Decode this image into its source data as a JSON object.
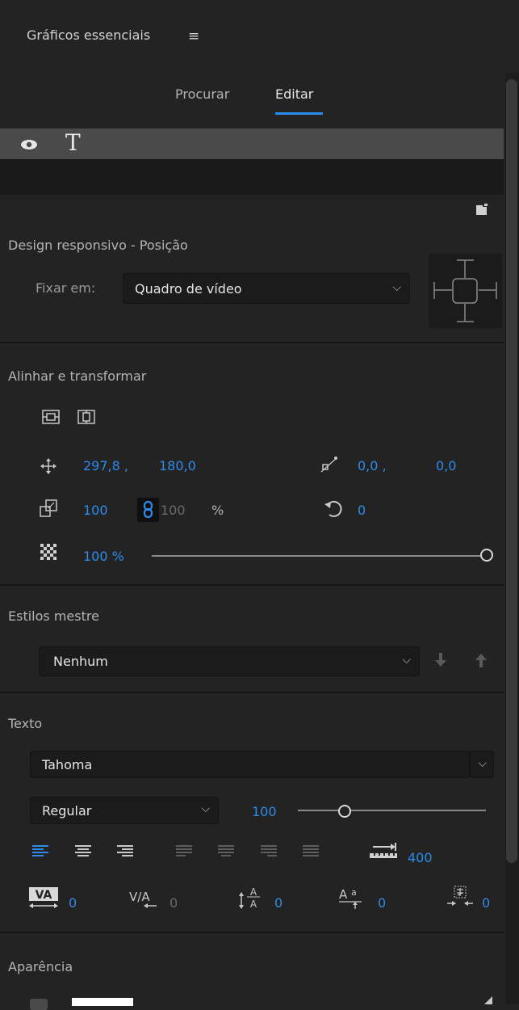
{
  "panel": {
    "title": "Gráficos essenciais"
  },
  "tabs": [
    {
      "label": "Procurar"
    },
    {
      "label": "Editar"
    }
  ],
  "responsive": {
    "title": "Design responsivo - Posição",
    "pin_label": "Fixar em:",
    "pin_value": "Quadro de vídeo"
  },
  "align": {
    "title": "Alinhar e transformar",
    "pos_x": "297,8 ,",
    "pos_y": "180,0",
    "anchor_x": "0,0 ,",
    "anchor_y": "0,0",
    "scale": "100",
    "scale_h": "100",
    "scale_unit": "%",
    "rotation": "0",
    "opacity": "100 %"
  },
  "master": {
    "title": "Estilos mestre",
    "value": "Nenhum"
  },
  "text": {
    "title": "Texto",
    "font": "Tahoma",
    "style": "Regular",
    "size": "100",
    "tab_width": "400",
    "kerning": "0",
    "tracking": "0",
    "leading": "0",
    "baseline": "0",
    "tsume": "0"
  },
  "appearance": {
    "title": "Aparência"
  },
  "colors": {
    "accent": "#2d8ceb",
    "bg": "#232323"
  }
}
